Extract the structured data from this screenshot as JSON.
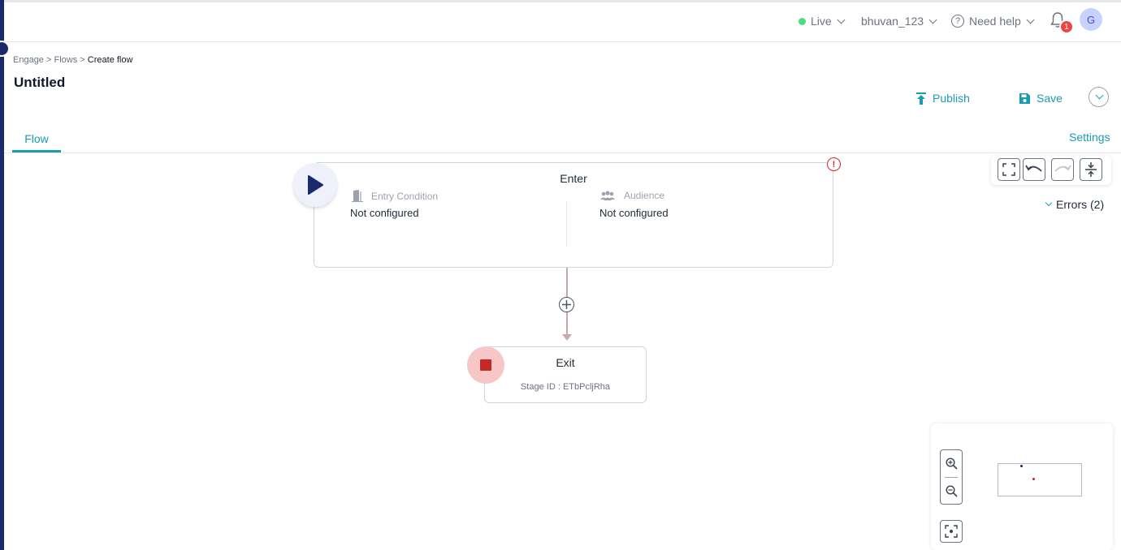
{
  "header": {
    "environment": "Live",
    "account": "bhuvan_123",
    "help": "Need help",
    "notification_count": "1",
    "avatar_initial": "G"
  },
  "breadcrumb": {
    "items": [
      "Engage",
      "Flows"
    ],
    "separator": ">",
    "current": "Create flow"
  },
  "page": {
    "title": "Untitled"
  },
  "actions": {
    "publish": "Publish",
    "save": "Save"
  },
  "tabs": {
    "flow": "Flow",
    "settings": "Settings"
  },
  "canvas": {
    "enter_node": {
      "title": "Enter",
      "entry_condition_label": "Entry Condition",
      "entry_condition_value": "Not configured",
      "audience_label": "Audience",
      "audience_value": "Not configured",
      "warning_glyph": "!"
    },
    "exit_node": {
      "title": "Exit",
      "stage_id": "Stage ID : ETbPcljRha"
    },
    "errors_toggle": "Errors (2)"
  },
  "colors": {
    "accent": "#1a9bb0",
    "live": "#4ade80",
    "error": "#dc2626",
    "exit": "#c62828",
    "sidebar": "#1a2a6c"
  }
}
